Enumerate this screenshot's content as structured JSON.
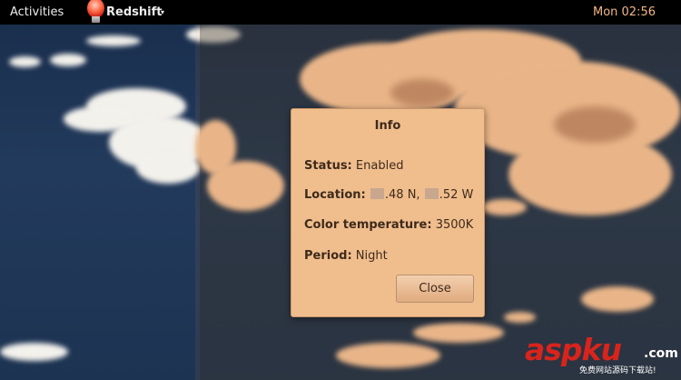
{
  "topbar": {
    "activities_label": "Activities",
    "app_name": "Redshift",
    "app_chevron": "▾",
    "app_icon": "redshift-bulb-icon",
    "clock": "Mon 02:56"
  },
  "dialog": {
    "title": "Info",
    "status_key": "Status:",
    "status_value": "Enabled",
    "location_key": "Location:",
    "location_lat": ".48 N,",
    "location_lon": ".52 W",
    "temp_key": "Color temperature:",
    "temp_value": "3500K",
    "period_key": "Period:",
    "period_value": "Night",
    "close_label": "Close"
  },
  "watermark": {
    "main": "aspku",
    "suffix": ".com",
    "subtitle": "免费网站源码下载站!"
  },
  "colors": {
    "topbar_bg": "#000000",
    "clock": "#f2b585",
    "dialog_bg": "#f0be8d",
    "watermark_red": "#d8241c"
  }
}
